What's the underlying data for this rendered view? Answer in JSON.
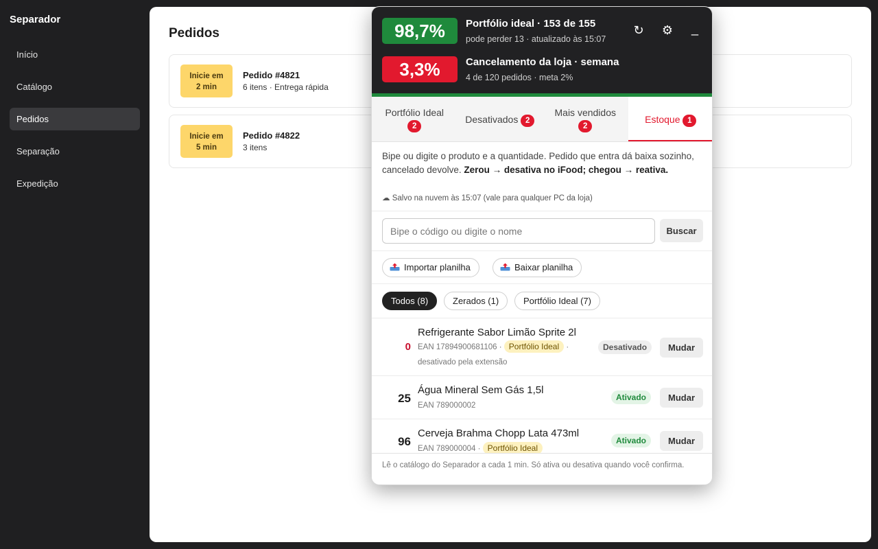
{
  "sidebar": {
    "brand": "Separador",
    "items": [
      {
        "label": "Início"
      },
      {
        "label": "Catálogo"
      },
      {
        "label": "Pedidos"
      },
      {
        "label": "Separação"
      },
      {
        "label": "Expedição"
      }
    ],
    "active_index": 2
  },
  "main": {
    "title": "Pedidos",
    "orders": [
      {
        "badge_line1": "Inicie em",
        "badge_line2": "2 min",
        "title": "Pedido #4821",
        "subtitle": "6 itens · Entrega rápida"
      },
      {
        "badge_line1": "Inicie em",
        "badge_line2": "5 min",
        "title": "Pedido #4822",
        "subtitle": "3 itens"
      }
    ]
  },
  "panel": {
    "metric1": {
      "value": "98,7%",
      "title": "Portfólio ideal · 153 de 155",
      "subtitle": "pode perder 13 · atualizado às 15:07",
      "color": "#1f8a3c"
    },
    "metric2": {
      "value": "3,3%",
      "title": "Cancelamento da loja · semana",
      "subtitle": "4 de 120 pedidos · meta 2%",
      "color": "#e2192e"
    },
    "icons": {
      "refresh": "↻",
      "settings": "⚙",
      "minimize": "_"
    },
    "progress_fraction": 0.987,
    "tabs": [
      {
        "label": "Portfólio Ideal",
        "count": "2"
      },
      {
        "label": "Desativados",
        "count": "2"
      },
      {
        "label": "Mais vendidos",
        "count": "2"
      },
      {
        "label": "Estoque",
        "count": "1"
      }
    ],
    "active_tab": 3,
    "intro_text": "Bipe ou digite o produto e a quantidade. Pedido que entra dá baixa sozinho, cancelado devolve. ",
    "intro_bold": "Zerou → desativa no iFood; chegou → reativa.",
    "saved_icon": "☁",
    "saved_text": "Salvo na nuvem às 15:07 (vale para qualquer PC da loja)",
    "search": {
      "placeholder": "Bipe o código ou digite o nome",
      "value": "",
      "button": "Buscar"
    },
    "import_label": "Importar planilha",
    "export_label": "Baixar planilha",
    "filters": [
      {
        "label": "Todos (8)"
      },
      {
        "label": "Zerados (1)"
      },
      {
        "label": "Portfólio Ideal (7)"
      }
    ],
    "products": [
      {
        "qty": "0",
        "name": "Refrigerante Sabor Limão Sprite 2l",
        "ean": "EAN 17894900681106 ·",
        "tag": "Portfólio Ideal",
        "tag_sep": "·",
        "note": "desativado pela extensão",
        "status": "Desativado",
        "action": "Mudar"
      },
      {
        "qty": "25",
        "name": "Água Mineral Sem Gás 1,5l",
        "ean": "EAN 789000002",
        "status": "Ativado",
        "action": "Mudar"
      },
      {
        "qty": "96",
        "name": "Cerveja Brahma Chopp Lata 473ml",
        "ean": "EAN 789000004 ·",
        "tag": "Portfólio Ideal",
        "status": "Ativado",
        "action": "Mudar"
      }
    ],
    "footer": "Lê o catálogo do Separador a cada 1 min. Só ativa ou desativa quando você confirma."
  }
}
